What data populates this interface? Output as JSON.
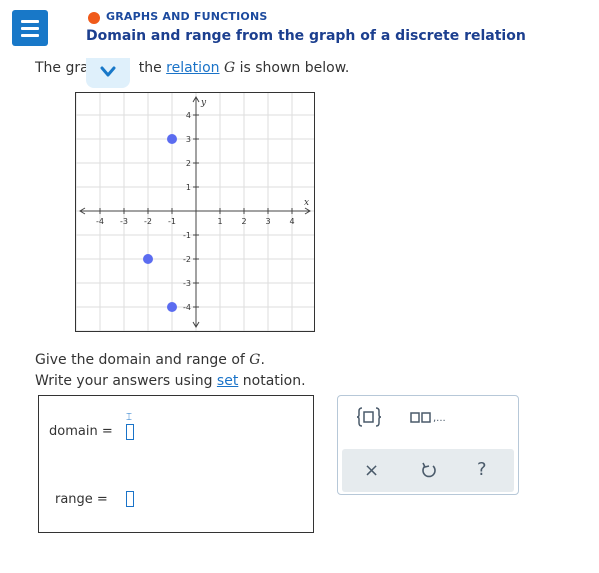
{
  "header": {
    "topic": "GRAPHS AND FUNCTIONS",
    "title": "Domain and range from the graph of a discrete relation",
    "accent_color": "#1878c8",
    "status_color": "#f05a1a"
  },
  "question": {
    "intro_before": "The gra",
    "intro_mid": "the ",
    "relation_link": "relation",
    "relation_var": "G",
    "intro_after": " is shown below.",
    "line1_before": "Give the domain and range of ",
    "line1_var": "G",
    "line1_after": ".",
    "line2_before": "Write your answers using ",
    "set_link": "set",
    "line2_after": " notation."
  },
  "chart_data": {
    "type": "scatter",
    "xlabel": "x",
    "ylabel": "y",
    "xlim": [
      -5,
      5
    ],
    "ylim": [
      -5,
      5
    ],
    "grid": true,
    "x_ticks": [
      "-4",
      "-3",
      "-2",
      "-1",
      "1",
      "2",
      "3",
      "4"
    ],
    "y_ticks": [
      "4",
      "3",
      "2",
      "1",
      "-1",
      "-2",
      "-3",
      "-4"
    ],
    "points": [
      {
        "x": -1,
        "y": 3
      },
      {
        "x": -2,
        "y": -2
      },
      {
        "x": -1,
        "y": -4
      }
    ],
    "point_color": "#5b6cf0"
  },
  "answer": {
    "domain_label": "domain  =",
    "range_label": "range  ="
  },
  "tools": {
    "set_braces_icon": "set-braces-icon",
    "list_icon": "ordered-list-icon",
    "list_suffix": ",...",
    "clear_label": "×",
    "undo_icon": "undo-icon",
    "help_label": "?"
  }
}
